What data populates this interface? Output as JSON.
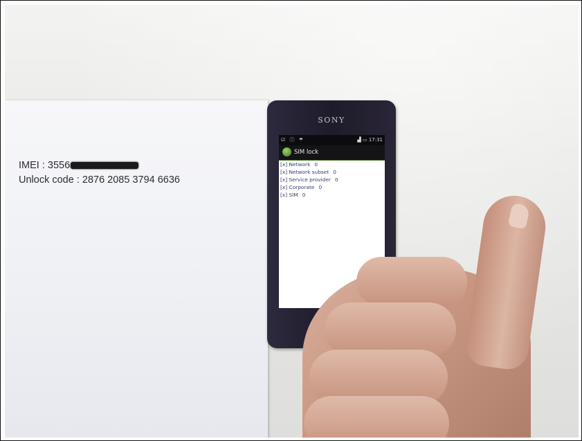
{
  "paper": {
    "imei_label": "IMEI : 3556",
    "unlock_label": "Unlock code : 2876 2085 3794 6636"
  },
  "phone": {
    "brand": "SONY",
    "status_time": "17:31",
    "app_title": "SIM lock",
    "lock_items": [
      {
        "label": "[x] Network",
        "value": "0"
      },
      {
        "label": "[x] Network subset",
        "value": "0"
      },
      {
        "label": "[x] Service provider",
        "value": "0"
      },
      {
        "label": "[x] Corporate",
        "value": "0"
      },
      {
        "label": "[x] SIM",
        "value": "0"
      }
    ],
    "back_icon": "back-arrow-icon"
  }
}
